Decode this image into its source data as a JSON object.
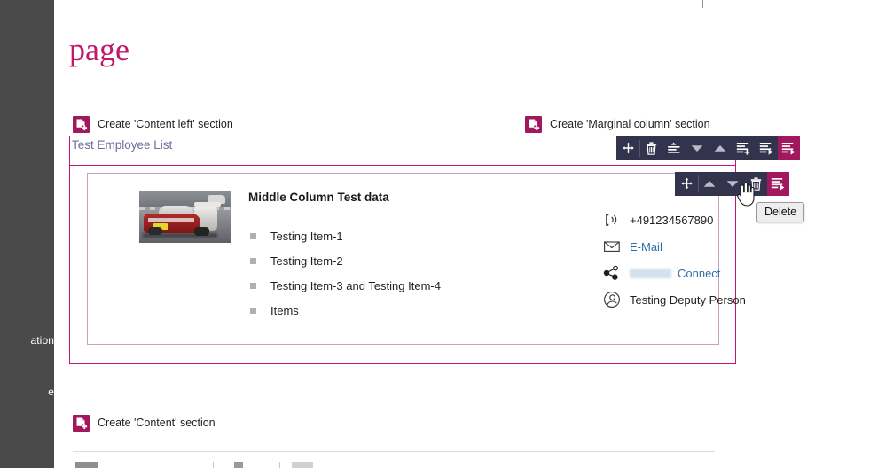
{
  "sidebar": {
    "fragment_top": "ation",
    "fragment_bottom": "e"
  },
  "page": {
    "title": "page"
  },
  "create_sections": [
    {
      "label": "Create 'Content left' section",
      "icon": "create-section-icon"
    },
    {
      "label": "Create 'Marginal column' section",
      "icon": "create-section-icon"
    },
    {
      "label": "Create 'Content' section",
      "icon": "create-section-icon"
    }
  ],
  "section": {
    "title": "Test Employee List"
  },
  "outer_toolbar": {
    "buttons": [
      {
        "name": "move-icon",
        "title": "Move"
      },
      {
        "name": "trash-icon",
        "title": "Delete"
      },
      {
        "name": "move-to-top-icon",
        "title": "Move to top"
      },
      {
        "name": "chevron-down-icon",
        "title": "Move down"
      },
      {
        "name": "chevron-up-icon",
        "title": "Move up"
      },
      {
        "name": "add-section-icon",
        "title": "Add section"
      },
      {
        "name": "insert-after-icon",
        "title": "Insert after"
      },
      {
        "name": "section-menu-icon",
        "title": "Section menu"
      }
    ]
  },
  "inner_toolbar": {
    "buttons": [
      {
        "name": "move-icon",
        "title": "Move"
      },
      {
        "name": "chevron-up-icon",
        "title": "Move up"
      },
      {
        "name": "chevron-down-icon",
        "title": "Move down"
      },
      {
        "name": "trash-icon",
        "title": "Delete"
      },
      {
        "name": "element-menu-icon",
        "title": "Element menu"
      }
    ]
  },
  "tooltip": {
    "text": "Delete"
  },
  "content": {
    "image_alt": "race-car-photo",
    "heading": "Middle Column Test data",
    "bullets": [
      "Testing Item-1",
      "Testing Item-2",
      "Testing Item-3 and Testing Item-4",
      "Items"
    ]
  },
  "contacts": [
    {
      "icon": "phone-icon",
      "text": "+491234567890",
      "link": false,
      "redacted": false
    },
    {
      "icon": "mail-icon",
      "text": "E-Mail",
      "link": true,
      "redacted": false
    },
    {
      "icon": "network-icon",
      "text": "Connect",
      "link": true,
      "redacted": true
    },
    {
      "icon": "person-icon",
      "text": "Testing Deputy Person",
      "link": false,
      "redacted": false
    }
  ],
  "colors": {
    "brand_magenta": "#c2186b",
    "brand_magenta_dark": "#a2185e",
    "toolbar_dark": "#33334d",
    "sidebar_gray": "#4a4a4a",
    "link_blue": "#2f6fa8",
    "section_title_blue": "#6b6f9c"
  }
}
